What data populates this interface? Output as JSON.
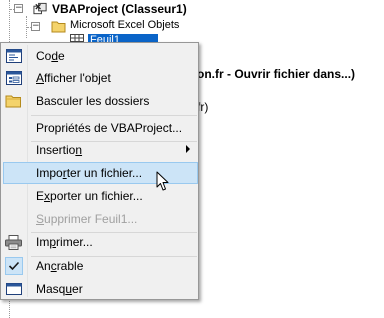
{
  "tree": {
    "project_label": "VBAProject (Classeur1)",
    "folder_label": "Microsoft Excel Objets",
    "selected_node": "Feuil1 (Feuil1)",
    "expander_minus": "−"
  },
  "background": {
    "line1": "on.fr -  Ouvrir fichier dans...)",
    "line2": "fr)"
  },
  "menu": {
    "items": [
      {
        "pre": "Co",
        "u": "d",
        "post": "e",
        "icon": "code-window-icon"
      },
      {
        "pre": "",
        "u": "A",
        "post": "fficher l'objet",
        "icon": "form-view-icon"
      },
      {
        "pre": "Basculer les dossiers",
        "u": "",
        "post": "",
        "icon": "folder-icon"
      },
      {
        "pre": "Propriétés de VBAProject...",
        "u": "",
        "post": ""
      },
      {
        "pre": "Insertio",
        "u": "n",
        "post": "",
        "submenu": true
      },
      {
        "pre": "Impo",
        "u": "r",
        "post": "ter un fichier...",
        "hover": true
      },
      {
        "pre": "E",
        "u": "x",
        "post": "porter un fichier..."
      },
      {
        "pre": "",
        "u": "S",
        "post": "upprimer Feuil1...",
        "disabled": true
      },
      {
        "pre": "Im",
        "u": "p",
        "post": "rimer...",
        "icon": "printer-icon"
      },
      {
        "pre": "An",
        "u": "c",
        "post": "rable",
        "checked": true
      },
      {
        "pre": "Masq",
        "u": "u",
        "post": "er",
        "icon": "hide-window-icon"
      }
    ]
  },
  "colors": {
    "menu_bg": "#f0f0f0",
    "hover_bg": "#cce4f7",
    "hover_border": "#99c9ef",
    "selection_blue": "#0a64c8",
    "disabled_text": "#a0a0a0"
  }
}
